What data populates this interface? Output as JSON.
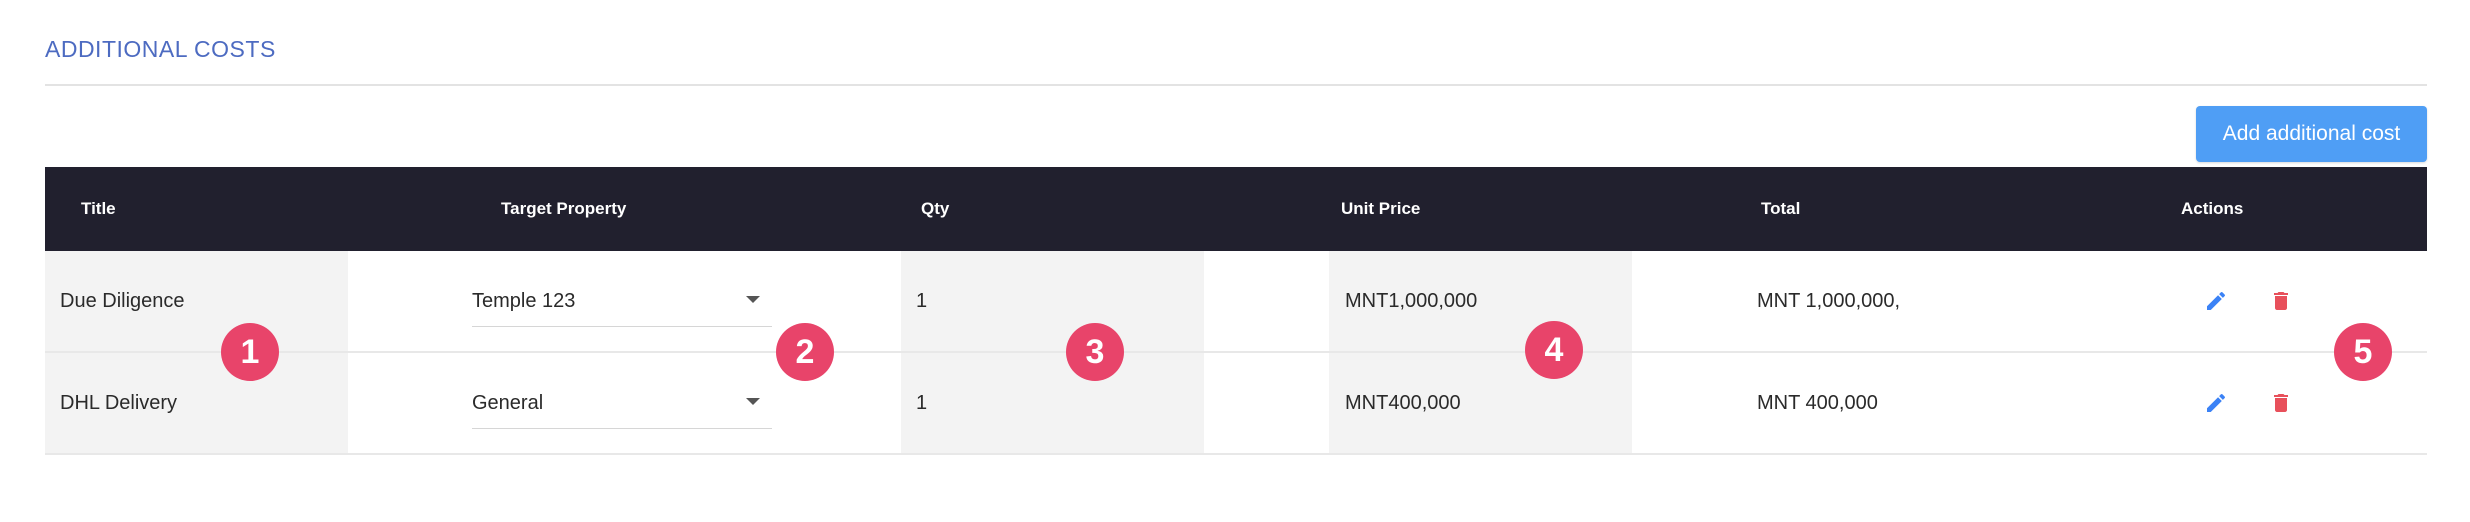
{
  "section": {
    "title": "ADDITIONAL COSTS"
  },
  "toolbar": {
    "add_label": "Add additional cost"
  },
  "table": {
    "headers": {
      "title": "Title",
      "target_property": "Target Property",
      "qty": "Qty",
      "unit_price": "Unit Price",
      "total": "Total",
      "actions": "Actions"
    },
    "rows": [
      {
        "title": "Due Diligence",
        "target_property": "Temple 123",
        "qty": "1",
        "unit_price": "MNT1,000,000",
        "total": "MNT 1,000,000,"
      },
      {
        "title": "DHL Delivery",
        "target_property": "General",
        "qty": "1",
        "unit_price": "MNT400,000",
        "total": "MNT 400,000"
      }
    ]
  },
  "annotations": [
    "1",
    "2",
    "3",
    "4",
    "5"
  ],
  "colors": {
    "accent": "#4d6bc1",
    "button": "#4f9ef5",
    "header_bg": "#21202e",
    "edit_icon": "#3b82f6",
    "delete_icon": "#e8505b",
    "badge": "#e8446a"
  },
  "icons": {
    "edit": "pencil-icon",
    "delete": "trash-icon",
    "dropdown": "caret-down-icon"
  }
}
